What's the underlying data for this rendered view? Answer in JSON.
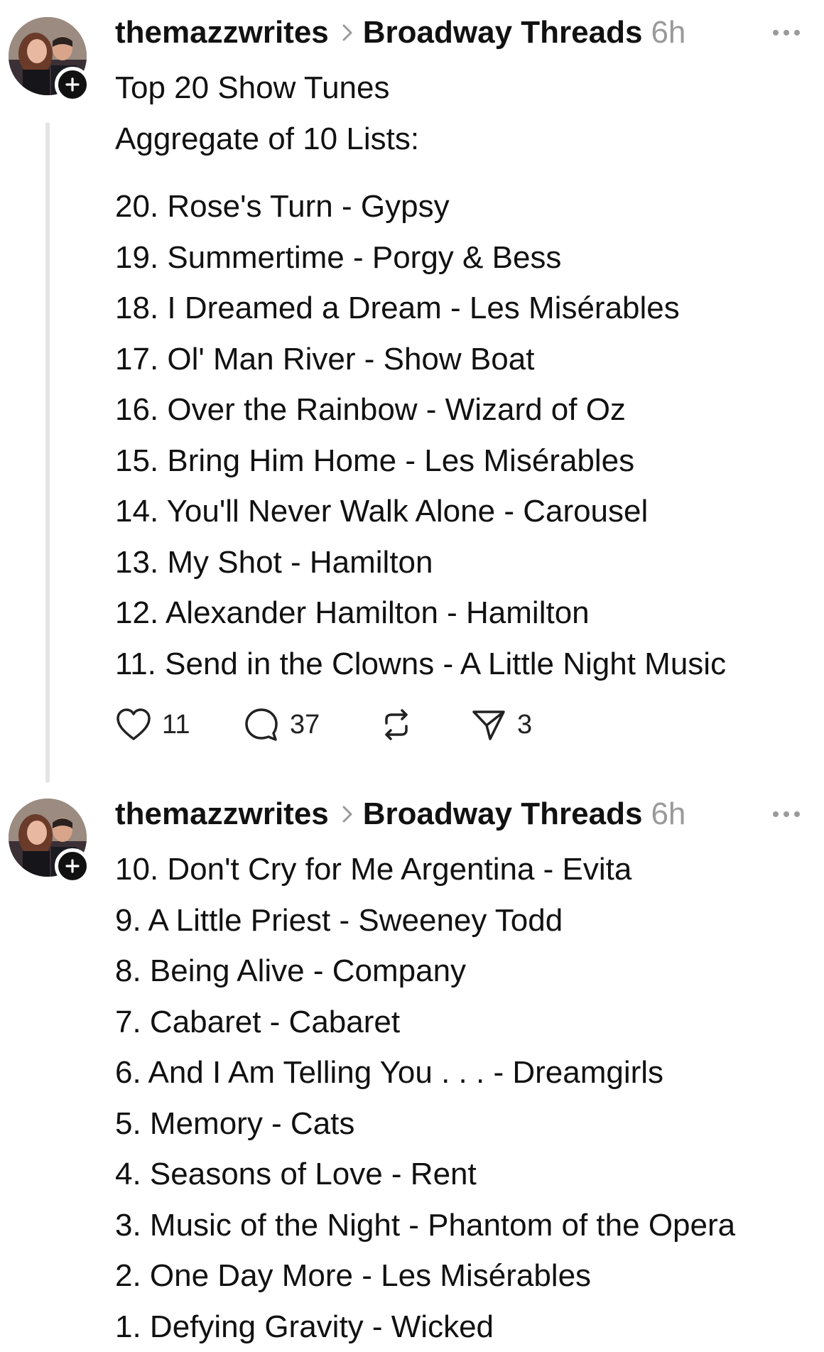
{
  "posts": [
    {
      "username": "themazzwrites",
      "community": "Broadway Threads",
      "time": "6h",
      "lines": [
        "Top 20 Show Tunes",
        "Aggregate of 10 Lists:"
      ],
      "list": [
        "20. Rose's Turn - Gypsy",
        "19. Summertime - Porgy & Bess",
        "18. I Dreamed a Dream - Les Misérables",
        "17. Ol' Man River - Show Boat",
        "16. Over the Rainbow - Wizard of Oz",
        "15. Bring Him Home - Les Misérables",
        "14. You'll Never Walk Alone - Carousel",
        "13. My Shot - Hamilton",
        "12. Alexander Hamilton - Hamilton",
        "11. Send in the Clowns - A Little Night Music"
      ],
      "actions": {
        "likes": "11",
        "replies": "37",
        "shares": "3"
      }
    },
    {
      "username": "themazzwrites",
      "community": "Broadway Threads",
      "time": "6h",
      "list": [
        "10. Don't Cry for Me Argentina - Evita",
        "9. A Little Priest - Sweeney Todd",
        "8. Being Alive - Company",
        "7. Cabaret - Cabaret",
        "6. And I Am Telling You . . . - Dreamgirls",
        "5. Memory - Cats",
        "4. Seasons of Love - Rent",
        "3. Music of the Night - Phantom of the Opera",
        "2. One Day More - Les Misérables",
        "1. Defying Gravity - Wicked"
      ]
    }
  ],
  "icons": {
    "chevron": "chevron-right-icon",
    "more": "more-horizontal-icon",
    "follow": "plus-icon",
    "like": "heart-icon",
    "reply": "comment-bubble-icon",
    "repost": "repost-icon",
    "share": "send-icon"
  },
  "colors": {
    "text": "#111111",
    "muted": "#9a9a9a",
    "thread_line": "#e4e4e4"
  }
}
